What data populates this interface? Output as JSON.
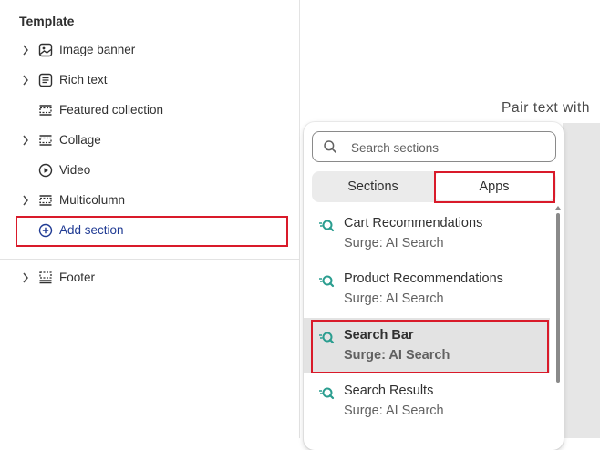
{
  "sidebar": {
    "heading": "Template",
    "items": [
      {
        "label": "Image banner",
        "icon": "image-icon",
        "chevron": true
      },
      {
        "label": "Rich text",
        "icon": "text-block-icon",
        "chevron": true
      },
      {
        "label": "Featured collection",
        "icon": "layout-section-icon",
        "chevron": false
      },
      {
        "label": "Collage",
        "icon": "layout-section-icon",
        "chevron": true
      },
      {
        "label": "Video",
        "icon": "play-icon",
        "chevron": false
      },
      {
        "label": "Multicolumn",
        "icon": "layout-section-icon",
        "chevron": true
      }
    ],
    "add_section": "Add section",
    "footer": "Footer"
  },
  "canvas": {
    "preview_text": "Pair text with"
  },
  "picker": {
    "search_placeholder": "Search sections",
    "tabs": [
      "Sections",
      "Apps"
    ],
    "active_tab": "Apps",
    "apps": [
      {
        "title": "Cart Recommendations",
        "subtitle": "Surge: AI Search",
        "selected": false
      },
      {
        "title": "Product Recommendations",
        "subtitle": "Surge: AI Search",
        "selected": false
      },
      {
        "title": "Search Bar",
        "subtitle": "Surge: AI Search",
        "selected": true
      },
      {
        "title": "Search Results",
        "subtitle": "Surge: AI Search",
        "selected": false
      }
    ]
  },
  "colors": {
    "highlight_red": "#d91a2a",
    "app_icon_teal": "#2a9d8f",
    "add_blue": "#1f3a93"
  }
}
